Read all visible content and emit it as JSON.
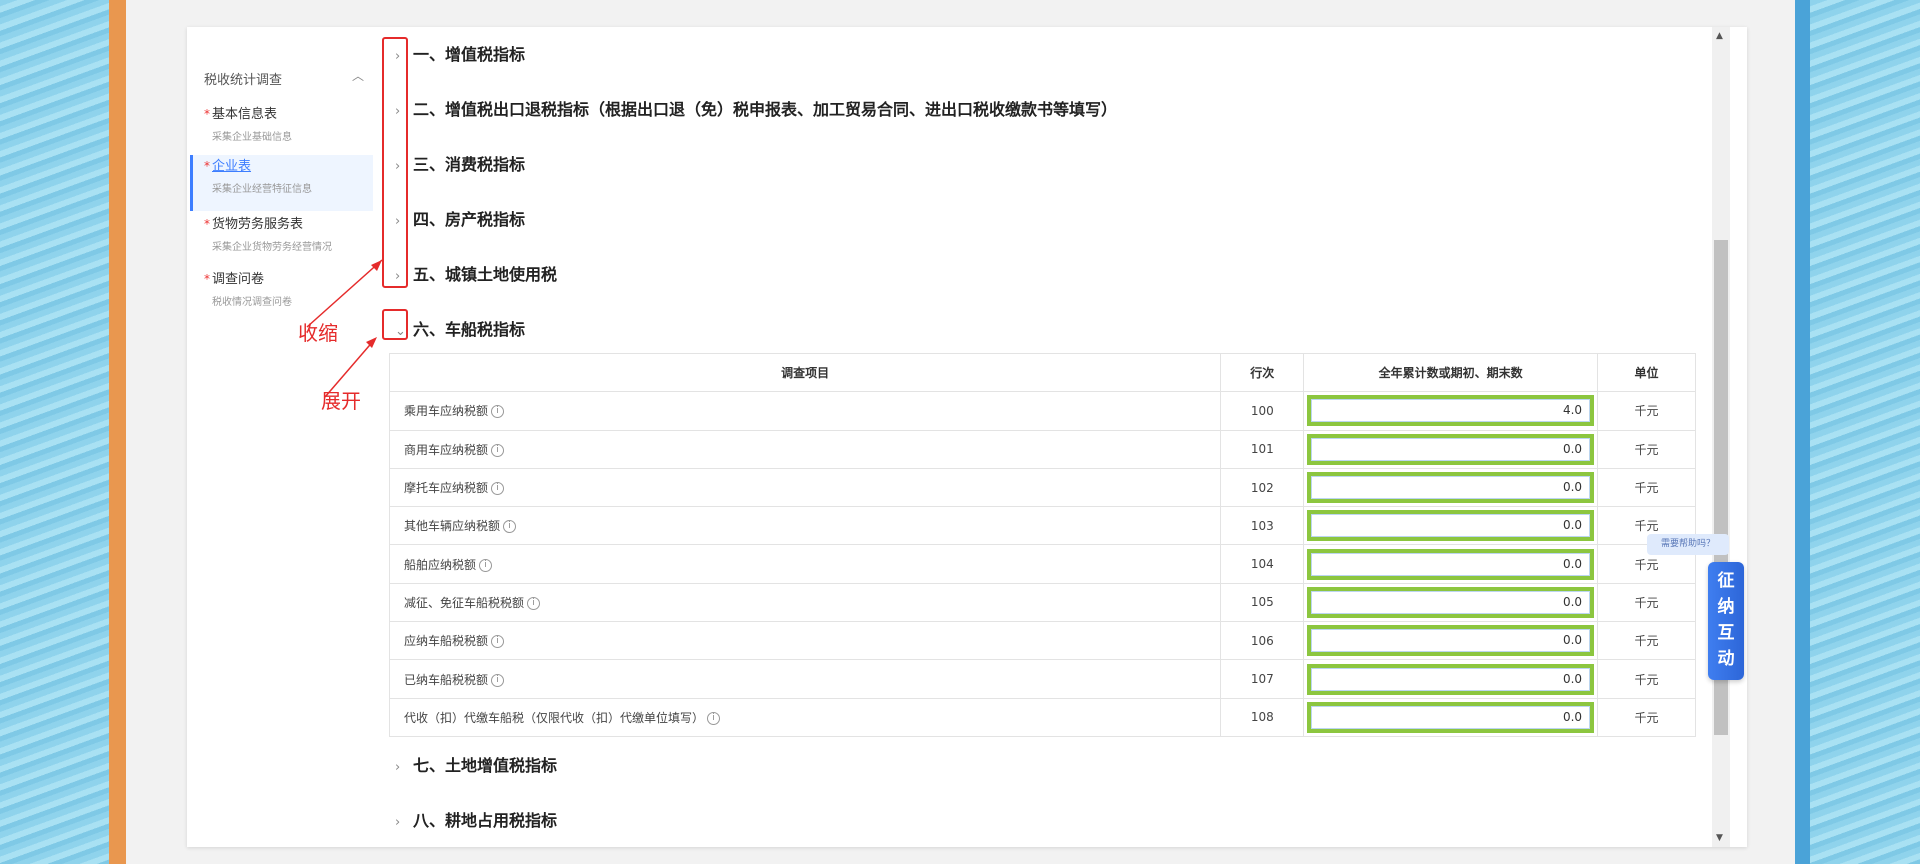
{
  "sidebar": {
    "title": "税收统计调查",
    "items": [
      {
        "label": "基本信息表",
        "sub": "采集企业基础信息"
      },
      {
        "label": "企业表",
        "sub": "采集企业经营特征信息"
      },
      {
        "label": "货物劳务服务表",
        "sub": "采集企业货物劳务经营情况"
      },
      {
        "label": "调查问卷",
        "sub": "税收情况调查问卷"
      }
    ]
  },
  "sections": [
    "一、增值税指标",
    "二、增值税出口退税指标（根据出口退（免）税申报表、加工贸易合同、进出口税收缴款书等填写）",
    "三、消费税指标",
    "四、房产税指标",
    "五、城镇土地使用税",
    "六、车船税指标",
    "七、土地增值税指标",
    "八、耕地占用税指标"
  ],
  "annotations": {
    "collapse": "收缩",
    "expand": "展开"
  },
  "table": {
    "headers": [
      "调查项目",
      "行次",
      "全年累计数或期初、期末数",
      "单位"
    ],
    "rows": [
      {
        "item": "乘用车应纳税额",
        "line": "100",
        "value": "4.0",
        "unit": "千元"
      },
      {
        "item": "商用车应纳税额",
        "line": "101",
        "value": "0.0",
        "unit": "千元"
      },
      {
        "item": "摩托车应纳税额",
        "line": "102",
        "value": "0.0",
        "unit": "千元"
      },
      {
        "item": "其他车辆应纳税额",
        "line": "103",
        "value": "0.0",
        "unit": "千元"
      },
      {
        "item": "船舶应纳税额",
        "line": "104",
        "value": "0.0",
        "unit": "千元"
      },
      {
        "item": "减征、免征车船税税额",
        "line": "105",
        "value": "0.0",
        "unit": "千元"
      },
      {
        "item": "应纳车船税税额",
        "line": "106",
        "value": "0.0",
        "unit": "千元"
      },
      {
        "item": "已纳车船税税额",
        "line": "107",
        "value": "0.0",
        "unit": "千元"
      },
      {
        "item": "代收（扣）代缴车船税（仅限代收（扣）代缴单位填写）",
        "line": "108",
        "value": "0.0",
        "unit": "千元"
      }
    ]
  },
  "help": {
    "bubble": "需要帮助吗？",
    "button": "征纳互动"
  },
  "colors": {
    "accent": "#3d7eff",
    "annotation": "#e52b2b",
    "input_border": "#8cc63f"
  }
}
